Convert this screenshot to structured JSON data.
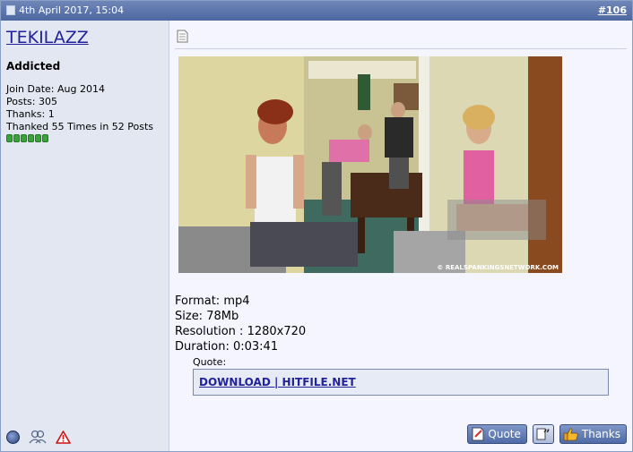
{
  "header": {
    "date": "4th April 2017, 15:04",
    "post_number": "#106"
  },
  "user": {
    "name": "TEKILAZZ",
    "title": "Addicted",
    "join_date": "Join Date: Aug 2014",
    "posts": "Posts: 305",
    "thanks": "Thanks: 1",
    "thanked": "Thanked 55 Times in 52 Posts",
    "reputation_pips": 6
  },
  "post": {
    "watermark": "© REALSPANKINGSNETWORK.COM",
    "format": "Format: mp4",
    "size": "Size: 78Mb",
    "resolution": "Resolution : 1280x720",
    "duration": "Duration: 0:03:41",
    "quote_label": "Quote:",
    "quote_link": "DOWNLOAD | HITFILE.NET"
  },
  "actions": {
    "quote": "Quote",
    "thanks": "Thanks"
  },
  "icons": [
    "post-icon",
    "online-status-icon",
    "user-profile-icon",
    "report-icon",
    "quote-icon",
    "multiquote-icon",
    "thumbs-up-icon"
  ],
  "colors": {
    "header": "#5a72aa",
    "sidebar": "#e3e7f2",
    "link": "#22229a"
  }
}
